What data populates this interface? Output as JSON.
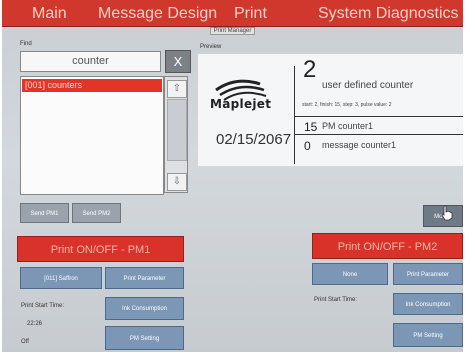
{
  "menu": {
    "items": [
      "Main",
      "Message Design",
      "Print",
      "System Diagnostics"
    ]
  },
  "window_title": "Print Manager",
  "find": {
    "label": "Find",
    "search_value": "counter",
    "clear_label": "X",
    "list_items": [
      "[001] counters"
    ],
    "scroll_up": "⇧",
    "scroll_down": "⇩"
  },
  "send_pm1_label": "Send PM1",
  "send_pm2_label": "Send PM2",
  "preview": {
    "label": "Preview",
    "logo_text": "Maplejet",
    "date": "02/15/2067",
    "user_defined_value": "2",
    "user_defined_label": "user defined counter",
    "detail_line": "start: 2, finish: 15, step: 3, pulse value: 2",
    "pm_counter_value": "15",
    "pm_counter_label": "PM counter1",
    "message_counter_value": "0",
    "message_counter_label": "message counter1"
  },
  "modify_label": "Modify",
  "pm1": {
    "title": "Print ON/OFF - PM1",
    "message_button": "[011] Saffron",
    "print_parameter": "Print Parameter",
    "start_time_label": "Print Start Time:",
    "start_time_value": "22:26",
    "ink_consumption": "Ink Consumption",
    "pm_setting": "PM Setting",
    "status": "Off"
  },
  "pm2": {
    "title": "Print ON/OFF - PM2",
    "message_button": "None",
    "print_parameter": "Print Parameter",
    "start_time_label": "Print Start Time:",
    "ink_consumption": "Ink Consumption",
    "pm_setting": "PM Setting"
  },
  "colors": {
    "menu_bar": "#d0382d",
    "selected_item": "#e33428",
    "print_bar": "#d9322a",
    "blue_button": "#7c97b6"
  },
  "icons": {
    "cursor": "hand-pointer-icon",
    "logo": "maplejet-swoosh-logo"
  }
}
